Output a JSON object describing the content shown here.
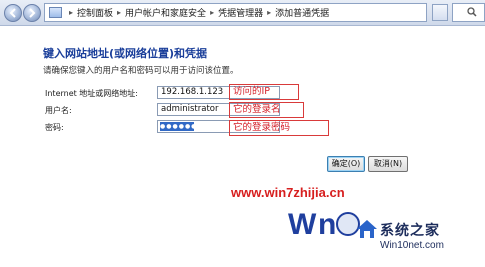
{
  "breadcrumb": {
    "items": [
      "控制面板",
      "用户帐户和家庭安全",
      "凭据管理器",
      "添加普通凭据"
    ]
  },
  "form": {
    "title": "键入网站地址(或网络位置)和凭据",
    "description": "请确保您键入的用户名和密码可以用于访问该位置。",
    "address_label": "Internet 地址或网络地址:",
    "address_value": "192.168.1.123",
    "username_label": "用户名:",
    "username_value": "administrator",
    "password_label": "密码:",
    "password_mask": "●●●●●●"
  },
  "annotations": {
    "address_note": "访问的IP",
    "username_note": "它的登录名",
    "password_note": "它的登录密码"
  },
  "buttons": {
    "ok": "确定(O)",
    "cancel": "取消(N)"
  },
  "watermark": {
    "url": "www.win7zhijia.cn",
    "brand": "系统之家",
    "brand_url": "Win10net.com"
  },
  "colors": {
    "title": "#1a3e9a",
    "annotation": "#d4202a",
    "watermark_url": "#d71f1f"
  }
}
